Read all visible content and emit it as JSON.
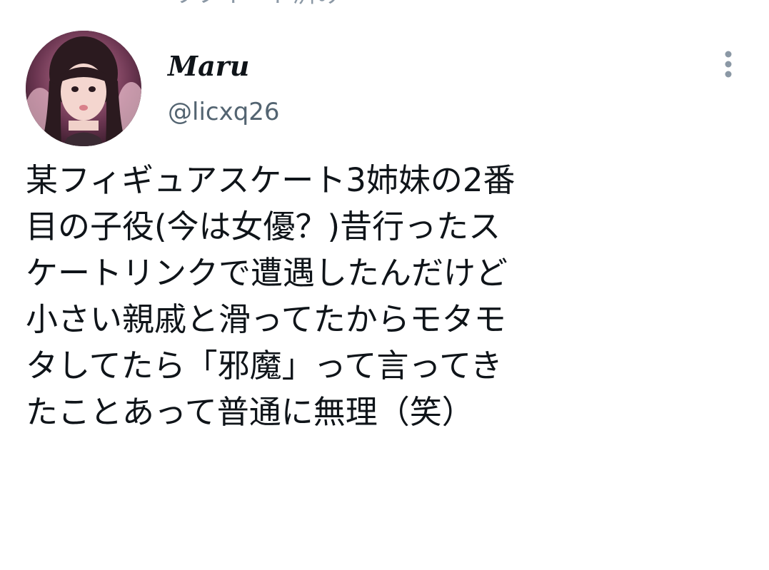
{
  "repost_status": "リツイート済み",
  "author": {
    "name": "Maru",
    "handle": "@licxq26"
  },
  "icons": {
    "avatar": "profile-photo",
    "more": "vertical-ellipsis-icon"
  },
  "tweet": {
    "lines": [
      "某フィギュアスケート3姉妹の2番",
      "目の子役(今は女優？)昔行ったス",
      "ケートリンクで遭遇したんだけど",
      "小さい親戚と滑ってたからモタモ",
      "タしてたら「邪魔」って言ってき",
      "たことあって普通に無理（笑）"
    ]
  },
  "colors": {
    "text_primary": "#0f1419",
    "text_secondary": "#536471",
    "icon_gray": "#8b98a5",
    "background": "#ffffff"
  }
}
